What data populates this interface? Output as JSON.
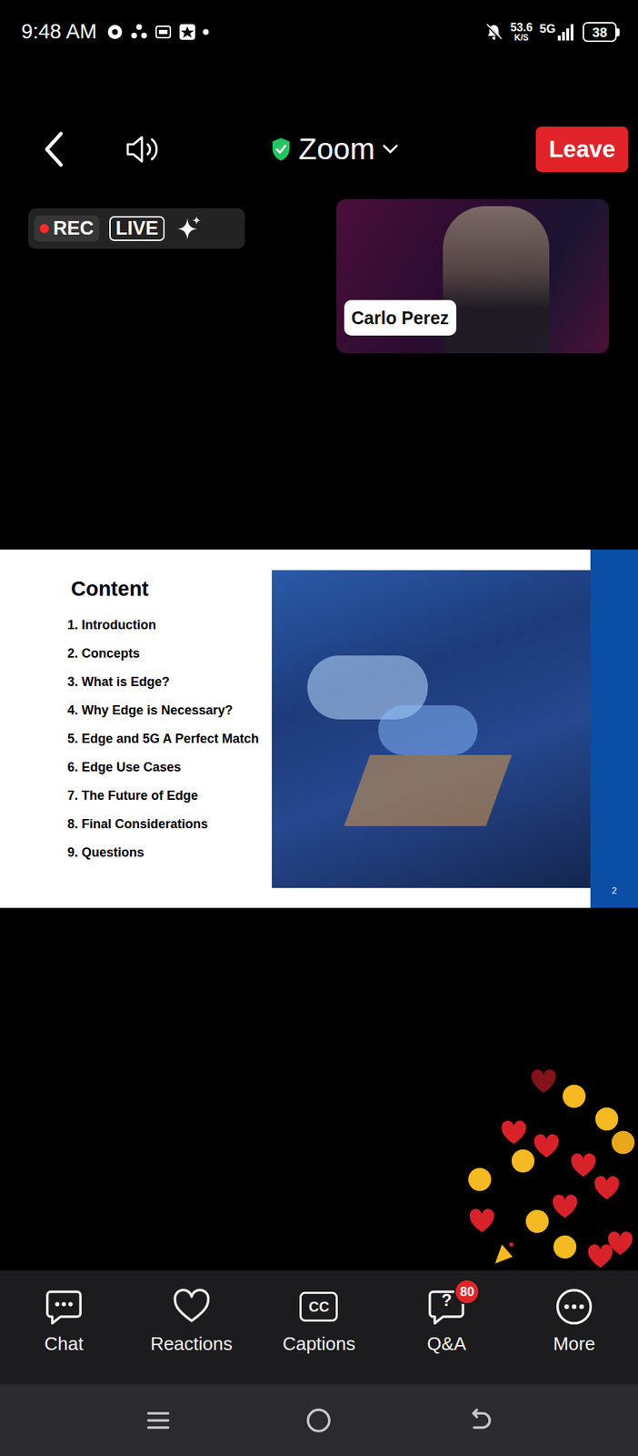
{
  "status_bar": {
    "time": "9:48 AM",
    "speed": "53.6",
    "speed_unit": "K/S",
    "network": "5G",
    "battery": "38"
  },
  "top_bar": {
    "app": "Zoom",
    "leave": "Leave"
  },
  "recording": {
    "on": true,
    "rec": "REC",
    "live": "LIVE"
  },
  "speaker": {
    "name": "Carlo Perez"
  },
  "slide": {
    "title": "Content",
    "items": [
      "1. Introduction",
      "2. Concepts",
      "3. What is Edge?",
      "4. Why Edge is Necessary?",
      "5. Edge and 5G A Perfect Match",
      "6. Edge Use Cases",
      "7. The Future of Edge",
      "8. Final Considerations",
      "9. Questions"
    ],
    "page": "2"
  },
  "toolbar": [
    {
      "label": "Chat",
      "kind": "chat"
    },
    {
      "label": "Reactions",
      "kind": "heart"
    },
    {
      "label": "Captions",
      "kind": "cc",
      "icon_text": "CC"
    },
    {
      "label": "Q&A",
      "kind": "qa",
      "icon_text": "?",
      "badge": "80"
    },
    {
      "label": "More",
      "kind": "more"
    }
  ]
}
